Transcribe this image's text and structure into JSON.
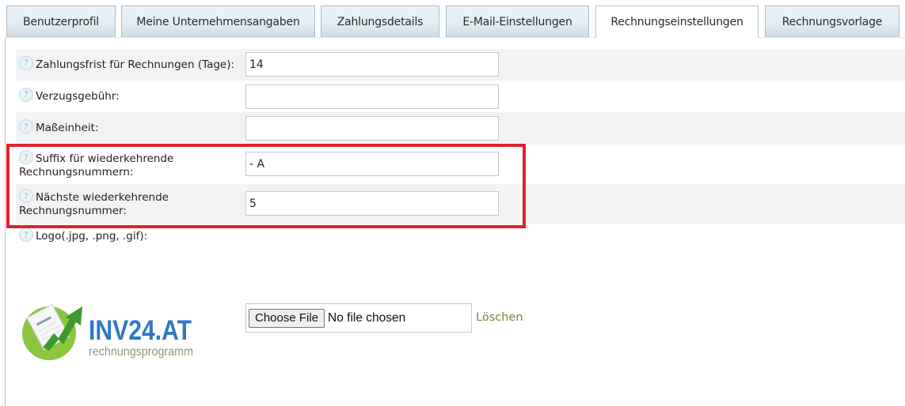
{
  "tabs": [
    {
      "label": "Benutzerprofil",
      "active": false
    },
    {
      "label": "Meine Unternehmensangaben",
      "active": false
    },
    {
      "label": "Zahlungsdetails",
      "active": false
    },
    {
      "label": "E-Mail-Einstellungen",
      "active": false
    },
    {
      "label": "Rechnungseinstellungen",
      "active": true
    },
    {
      "label": "Rechnungsvorlage",
      "active": false
    }
  ],
  "form": {
    "help_icon": "question-circle-icon",
    "fields": [
      {
        "label": "Zahlungsfrist für Rechnungen (Tage):",
        "value": "14",
        "placeholder": ""
      },
      {
        "label": "Verzugsgebühr:",
        "value": "",
        "placeholder": ""
      },
      {
        "label": "Maßeinheit:",
        "value": "",
        "placeholder": ""
      },
      {
        "label_line1": "Suffix für wiederkehrende",
        "label_line2": "Rechnungsnummern:",
        "value": "- A",
        "placeholder": ""
      },
      {
        "label_line1": "Nächste wiederkehrende",
        "label_line2": "Rechnungsnummer:",
        "value": "5",
        "placeholder": ""
      }
    ],
    "logo": {
      "label": "Logo(.jpg, .png, .gif):",
      "brand": "INV24.AT",
      "tagline": "rechnungsprogramm",
      "choose_file_label": "Choose File",
      "file_status": "No file chosen",
      "delete_label": "Löschen"
    }
  },
  "colors": {
    "highlight": "#e0212f",
    "link": "#6e8a3a",
    "brand_blue": "#2f78c4",
    "brand_green": "#8cc63f"
  }
}
